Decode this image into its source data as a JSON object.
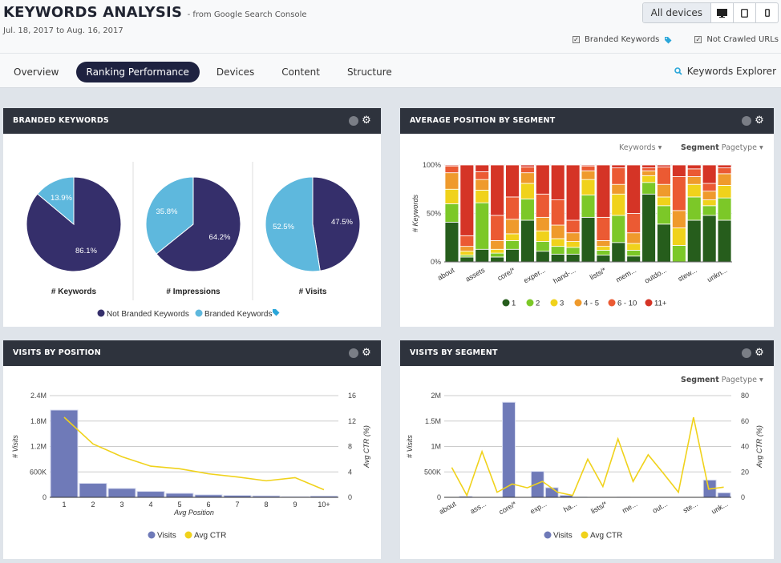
{
  "header": {
    "title": "KEYWORDS ANALYSIS",
    "subtitle": "- from Google Search Console",
    "date_range": "Jul. 18, 2017 to Aug. 16, 2017",
    "devices": {
      "all_label": "All devices",
      "icons": [
        "desktop-icon",
        "tablet-icon",
        "mobile-icon"
      ]
    },
    "filters": [
      {
        "label": "Branded Keywords",
        "checked": true,
        "tag_icon": true
      },
      {
        "label": "Not Crawled URLs",
        "checked": true
      }
    ]
  },
  "tabs": [
    {
      "label": "Overview",
      "active": false
    },
    {
      "label": "Ranking Performance",
      "active": true
    },
    {
      "label": "Devices",
      "active": false
    },
    {
      "label": "Content",
      "active": false
    },
    {
      "label": "Structure",
      "active": false
    }
  ],
  "keywords_explorer": "Keywords Explorer",
  "colors": {
    "navy": "#352f6b",
    "sky": "#5eb8dd",
    "bar": "#6f7ab8",
    "ctr": "#f0d21b",
    "pos1": "#265d1c",
    "pos2": "#7cc828",
    "pos3": "#f0d21b",
    "pos45": "#ef9a2c",
    "pos610": "#eb5a33",
    "pos11": "#d53426"
  },
  "panels": {
    "branded": {
      "title": "BRANDED KEYWORDS"
    },
    "avgpos": {
      "title": "AVERAGE POSITION BY SEGMENT",
      "metric_dropdown": "Keywords",
      "segment_label": "Segment",
      "segment_value": "Pagetype"
    },
    "visits_pos": {
      "title": "VISITS BY POSITION"
    },
    "visits_seg": {
      "title": "VISITS BY SEGMENT",
      "segment_label": "Segment",
      "segment_value": "Pagetype"
    }
  },
  "chart_data": [
    {
      "type": "pie",
      "title": "Branded Keywords",
      "legend": [
        "Not Branded Keywords",
        "Branded Keywords"
      ],
      "legend_position": "bottom",
      "pies": [
        {
          "label": "# Keywords",
          "values": [
            86.1,
            13.9
          ],
          "labels": [
            "86.1%",
            "13.9%"
          ]
        },
        {
          "label": "# Impressions",
          "values": [
            64.2,
            35.8
          ],
          "labels": [
            "64.2%",
            "35.8%"
          ]
        },
        {
          "label": "# Visits",
          "values": [
            47.5,
            52.5
          ],
          "labels": [
            "47.5%",
            "52.5%"
          ]
        }
      ]
    },
    {
      "type": "bar",
      "stacked": true,
      "title": "Average Position by Segment",
      "ylabel": "# Keywords",
      "yticks": [
        "0%",
        "50%",
        "100%"
      ],
      "ylim": [
        0,
        100
      ],
      "legend_position": "bottom",
      "x_tick_labels": [
        "about",
        "assets",
        "core/*",
        "exper...",
        "hand-...",
        "lists/*",
        "mem...",
        "outdo...",
        "stew...",
        "unkn..."
      ],
      "series_names": [
        "1",
        "2",
        "3",
        "4 - 5",
        "6 - 10",
        "11+"
      ],
      "bars": [
        [
          41,
          19,
          15,
          17,
          7,
          1
        ],
        [
          5,
          2,
          4,
          5,
          11,
          73
        ],
        [
          13,
          48,
          13,
          11,
          8,
          7
        ],
        [
          5,
          4,
          4,
          9,
          26,
          52
        ],
        [
          13,
          9,
          7,
          15,
          23,
          33
        ],
        [
          43,
          22,
          16,
          11,
          6,
          2
        ],
        [
          11,
          10,
          11,
          14,
          24,
          30
        ],
        [
          8,
          8,
          8,
          14,
          26,
          36
        ],
        [
          8,
          7,
          6,
          9,
          13,
          57
        ],
        [
          46,
          23,
          16,
          9,
          5,
          1
        ],
        [
          7,
          5,
          4,
          6,
          24,
          54
        ],
        [
          20,
          28,
          22,
          10,
          17,
          3
        ],
        [
          6,
          6,
          7,
          11,
          20,
          50
        ],
        [
          70,
          12,
          7,
          5,
          3,
          3
        ],
        [
          39,
          19,
          9,
          13,
          18,
          2
        ],
        [
          0,
          17,
          18,
          18,
          35,
          12
        ],
        [
          43,
          24,
          13,
          8,
          8,
          4
        ],
        [
          48,
          10,
          6,
          9,
          8,
          19
        ],
        [
          43,
          23,
          13,
          12,
          6,
          3
        ]
      ]
    },
    {
      "type": "bar",
      "title": "Visits by Position",
      "xlabel": "Avg Position",
      "ylabel": "# Visits",
      "y2label": "Avg CTR (%)",
      "categories": [
        "1",
        "2",
        "3",
        "4",
        "5",
        "6",
        "7",
        "8",
        "9",
        "10+"
      ],
      "yticks": [
        "0",
        "600K",
        "1.2M",
        "1.8M",
        "2.4M"
      ],
      "y2ticks": [
        "0",
        "4",
        "8",
        "12",
        "16"
      ],
      "ylim": [
        0,
        2400000
      ],
      "y2lim": [
        0,
        16
      ],
      "legend": [
        "Visits",
        "Avg CTR"
      ],
      "legend_position": "bottom",
      "series": [
        {
          "name": "Visits",
          "type": "bar",
          "values": [
            2060000,
            330000,
            210000,
            140000,
            95000,
            60000,
            45000,
            35000,
            18000,
            30000
          ]
        },
        {
          "name": "Avg CTR",
          "type": "line",
          "values": [
            12.6,
            8.4,
            6.4,
            4.9,
            4.5,
            3.7,
            3.2,
            2.6,
            3.1,
            1.2
          ]
        }
      ]
    },
    {
      "type": "bar",
      "title": "Visits by Segment",
      "ylabel": "# Visits",
      "y2label": "Avg CTR (%)",
      "x_tick_labels": [
        "about",
        "ass...",
        "core/*",
        "exp...",
        "ha...",
        "lists/*",
        "me...",
        "out...",
        "ste...",
        "unk..."
      ],
      "yticks": [
        "0",
        "500K",
        "1M",
        "1.5M",
        "2M"
      ],
      "y2ticks": [
        "0",
        "20",
        "40",
        "60",
        "80"
      ],
      "ylim": [
        0,
        2000000
      ],
      "y2lim": [
        0,
        80
      ],
      "legend": [
        "Visits",
        "Avg CTR"
      ],
      "legend_position": "bottom",
      "series": [
        {
          "name": "Visits",
          "type": "bar",
          "values": [
            0,
            20000,
            0,
            0,
            1870000,
            0,
            510000,
            190000,
            40000,
            5000,
            0,
            0,
            3000,
            0,
            0,
            0,
            0,
            0,
            340000,
            90000
          ]
        },
        {
          "name": "Avg CTR",
          "type": "line",
          "values": [
            23.5,
            1.5,
            36,
            4,
            10.5,
            7.5,
            12.5,
            4,
            1.5,
            30,
            8.5,
            46,
            12.5,
            33.5,
            19,
            4,
            63,
            6.5,
            8
          ]
        }
      ]
    }
  ]
}
